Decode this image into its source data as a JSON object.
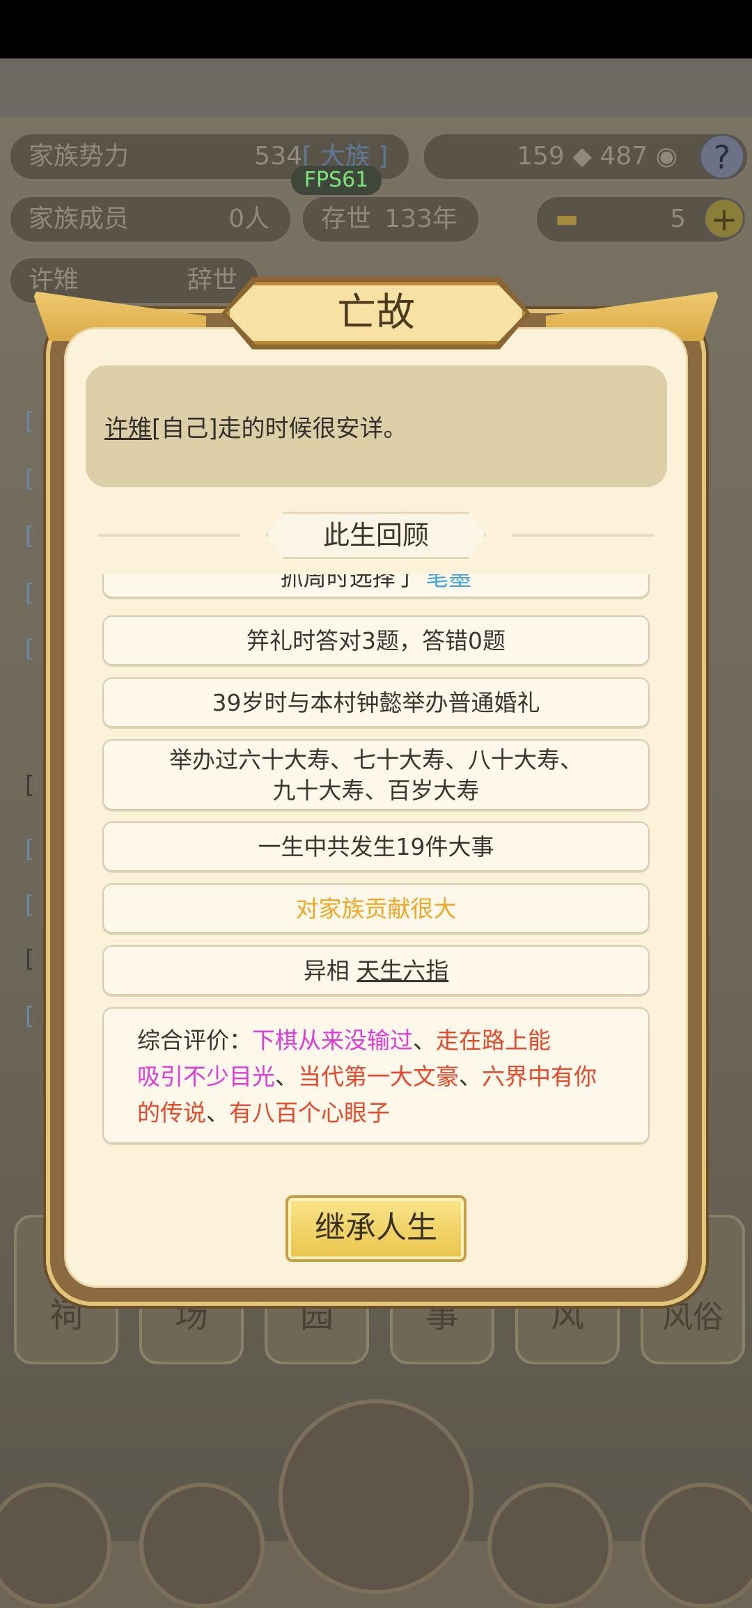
{
  "top_stats": {
    "power_label": "家族势力",
    "power_value": "534",
    "power_rank": "[ 大族 ]",
    "resource_a": "159",
    "resource_b": "487",
    "help_icon": "?",
    "members_label": "家族成员",
    "members_value": "0人",
    "lifespan_label": "存世",
    "lifespan_value": "133年",
    "gold_value": "5",
    "plus_icon": "+",
    "person_name": "许雉",
    "person_status": "辞世"
  },
  "fps": "FPS61",
  "dialog": {
    "title": "亡故",
    "death_name": "许雉",
    "death_rest": "[自己]走的时候很安详。",
    "review_title": "此生回顾",
    "rows": [
      {
        "text": "抓周时选择了",
        "highlight": "笔墨"
      },
      {
        "text": "笄礼时答对3题，答错0题"
      },
      {
        "text": "39岁时与本村钟懿举办普通婚礼"
      },
      {
        "line1": "举办过六十大寿、七十大寿、八十大寿、",
        "line2": "九十大寿、百岁大寿"
      },
      {
        "text": "一生中共发生19件大事"
      },
      {
        "text": "对家族贡献很大"
      },
      {
        "label": "异相",
        "trait": "天生六指"
      }
    ],
    "evaluation": {
      "label": "综合评价：",
      "t1": "下棋从来没输过",
      "sep1": "、",
      "t2": "走在路上能",
      "t3": "吸引不少目光",
      "sep2": "、",
      "t4": "当代第一大文豪",
      "sep3": "、",
      "t5": "六界中有你的传说",
      "sep4": "、",
      "t6": "有八百个心眼子"
    },
    "inherit_button": "继承人生"
  },
  "bottom_tabs": [
    "祠",
    "场",
    "园",
    "事",
    "风",
    "风俗"
  ],
  "colors": {
    "accent_gold": "#eac44a",
    "contribution": "#f0a626",
    "magenta": "#e03ad8",
    "red": "#e54a2c",
    "link_blue": "#3aa3e0"
  }
}
